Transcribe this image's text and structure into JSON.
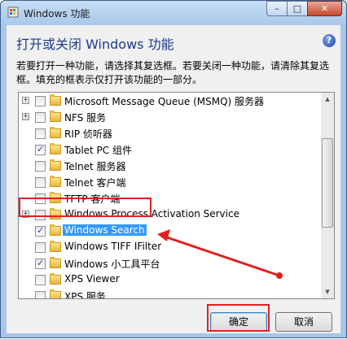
{
  "window": {
    "title": "Windows 功能",
    "minimize": "–",
    "maximize": "□",
    "close": "✕"
  },
  "heading": "打开或关闭 Windows 功能",
  "help": "?",
  "description": "若要打开一种功能，请选择其复选框。若要关闭一种功能，请清除其复选框。填充的框表示仅打开该功能的一部分。",
  "features": [
    {
      "label": "Microsoft Message Queue (MSMQ) 服务器",
      "expandable": true,
      "checked": false
    },
    {
      "label": "NFS 服务",
      "expandable": true,
      "checked": false
    },
    {
      "label": "RIP 侦听器",
      "expandable": false,
      "checked": false
    },
    {
      "label": "Tablet PC 组件",
      "expandable": false,
      "checked": true
    },
    {
      "label": "Telnet 服务器",
      "expandable": false,
      "checked": false
    },
    {
      "label": "Telnet 客户端",
      "expandable": false,
      "checked": false
    },
    {
      "label": "TFTP 客户端",
      "expandable": false,
      "checked": false
    },
    {
      "label": "Windows Process Activation Service",
      "expandable": true,
      "checked": false
    },
    {
      "label": "Windows Search",
      "expandable": false,
      "checked": true,
      "selected": true
    },
    {
      "label": "Windows TIFF IFilter",
      "expandable": false,
      "checked": false
    },
    {
      "label": "Windows 小工具平台",
      "expandable": false,
      "checked": true
    },
    {
      "label": "XPS Viewer",
      "expandable": false,
      "checked": false
    },
    {
      "label": "XPS 服务",
      "expandable": false,
      "checked": false
    }
  ],
  "buttons": {
    "ok": "确定",
    "cancel": "取消"
  },
  "colors": {
    "highlight": "#e02020",
    "selection": "#3399ff"
  }
}
